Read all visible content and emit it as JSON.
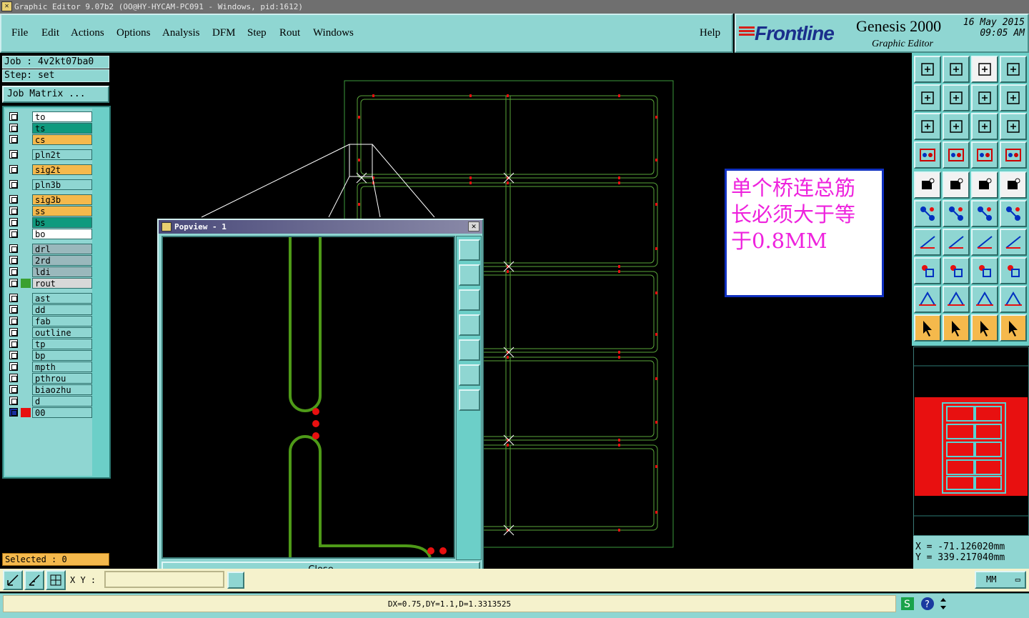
{
  "window": {
    "title": "Graphic Editor 9.07b2 (OO@HY-HYCAM-PC091 - Windows, pid:1612)"
  },
  "menu": [
    "File",
    "Edit",
    "Actions",
    "Options",
    "Analysis",
    "DFM",
    "Step",
    "Rout",
    "Windows"
  ],
  "help_label": "Help",
  "brand": {
    "logo": "Frontline",
    "product": "Genesis 2000",
    "subtitle": "Graphic Editor",
    "date": "16 May 2015",
    "time": "09:05 AM"
  },
  "job": {
    "label": "Job : 4v2kt07ba0",
    "step": "Step: set",
    "matrix_button": "Job Matrix ..."
  },
  "layers": [
    {
      "name": "to",
      "color": "#ffffff"
    },
    {
      "name": "ts",
      "color": "#0f9a7e"
    },
    {
      "name": "cs",
      "color": "#f5b94c"
    },
    {
      "name": "pln2t",
      "color": "#8fd6d2"
    },
    {
      "name": "sig2t",
      "color": "#f5b94c"
    },
    {
      "name": "pln3b",
      "color": "#8fd6d2"
    },
    {
      "name": "sig3b",
      "color": "#f5b94c"
    },
    {
      "name": "ss",
      "color": "#f5b94c"
    },
    {
      "name": "bs",
      "color": "#0f9a7e"
    },
    {
      "name": "bo",
      "color": "#ffffff"
    },
    {
      "name": "drl",
      "color": "#9ab8bc"
    },
    {
      "name": "2rd",
      "color": "#9ab8bc"
    },
    {
      "name": "ldi",
      "color": "#9ab8bc"
    },
    {
      "name": "rout",
      "color": "#d8d8d8"
    },
    {
      "name": "ast",
      "color": "#8fd6d2"
    },
    {
      "name": "dd",
      "color": "#8fd6d2"
    },
    {
      "name": "fab",
      "color": "#8fd6d2"
    },
    {
      "name": "outline",
      "color": "#8fd6d2"
    },
    {
      "name": "tp",
      "color": "#8fd6d2"
    },
    {
      "name": "bp",
      "color": "#8fd6d2"
    },
    {
      "name": "mpth",
      "color": "#8fd6d2"
    },
    {
      "name": "pthrou",
      "color": "#8fd6d2"
    },
    {
      "name": "biaozhu",
      "color": "#8fd6d2"
    },
    {
      "name": "d",
      "color": "#8fd6d2"
    },
    {
      "name": "00",
      "color": "#8fd6d2"
    }
  ],
  "selected": "Selected : 0",
  "note": {
    "line1": "单个桥连总筋",
    "line2": "长必须大于等",
    "line3": "于0.8MM"
  },
  "popview": {
    "title": "Popview - 1",
    "close_label": "Close"
  },
  "coords": {
    "x": "X  =  -71.126020mm",
    "y": "Y  =  339.217040mm"
  },
  "xy_label": "X Y :",
  "units": "MM",
  "status": "DX=0.75,DY=1.1,D=1.3313525"
}
